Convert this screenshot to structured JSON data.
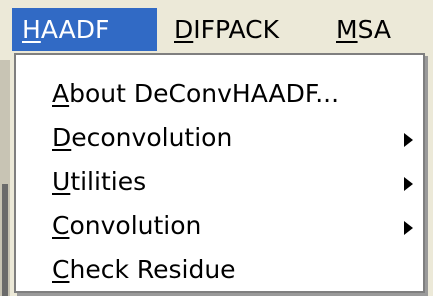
{
  "menubar": {
    "items": [
      {
        "hotkey": "H",
        "rest": "AADF"
      },
      {
        "hotkey": "D",
        "rest": "IFPACK"
      },
      {
        "hotkey": "M",
        "rest": "SA"
      }
    ]
  },
  "dropdown": {
    "items": [
      {
        "hotkey": "A",
        "rest": "bout DeConvHAADF..."
      },
      {
        "hotkey": "D",
        "rest": "econvolution"
      },
      {
        "hotkey": "U",
        "rest": "tilities"
      },
      {
        "hotkey": "C",
        "rest": "onvolution"
      },
      {
        "hotkey": "C",
        "rest": "heck Residue"
      }
    ]
  },
  "icons": {
    "submenu_arrow": "submenu-arrow-icon"
  }
}
